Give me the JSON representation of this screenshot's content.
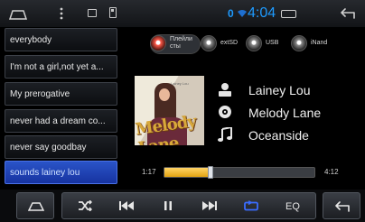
{
  "status_bar": {
    "notification_count": "0",
    "time": "4:04"
  },
  "sources": [
    {
      "label": "Плейли\nсты",
      "active": true
    },
    {
      "label": "extSD",
      "active": false
    },
    {
      "label": "USB",
      "active": false
    },
    {
      "label": "iNand",
      "active": false
    }
  ],
  "playlist": {
    "items": [
      {
        "title": "everybody"
      },
      {
        "title": "I'm not a girl,not yet a..."
      },
      {
        "title": "My prerogative"
      },
      {
        "title": "never had a dream co..."
      },
      {
        "title": "never say goodbay"
      },
      {
        "title": "sounds lainey lou"
      }
    ],
    "active_index": 5
  },
  "now_playing": {
    "artist": "Lainey Lou",
    "album": "Melody Lane",
    "title": "Oceanside",
    "album_art_text": "Melody Lane",
    "album_art_tag": "Lainey Lou"
  },
  "progress": {
    "elapsed": "1:17",
    "total": "4:12",
    "fraction": 0.31
  },
  "controls": {
    "eq_label": "EQ"
  },
  "colors": {
    "accent": "#1e9bff",
    "active_item": "#2a54c8",
    "progress_fill": "#f0b52a",
    "repeat_icon": "#3a6cff"
  }
}
